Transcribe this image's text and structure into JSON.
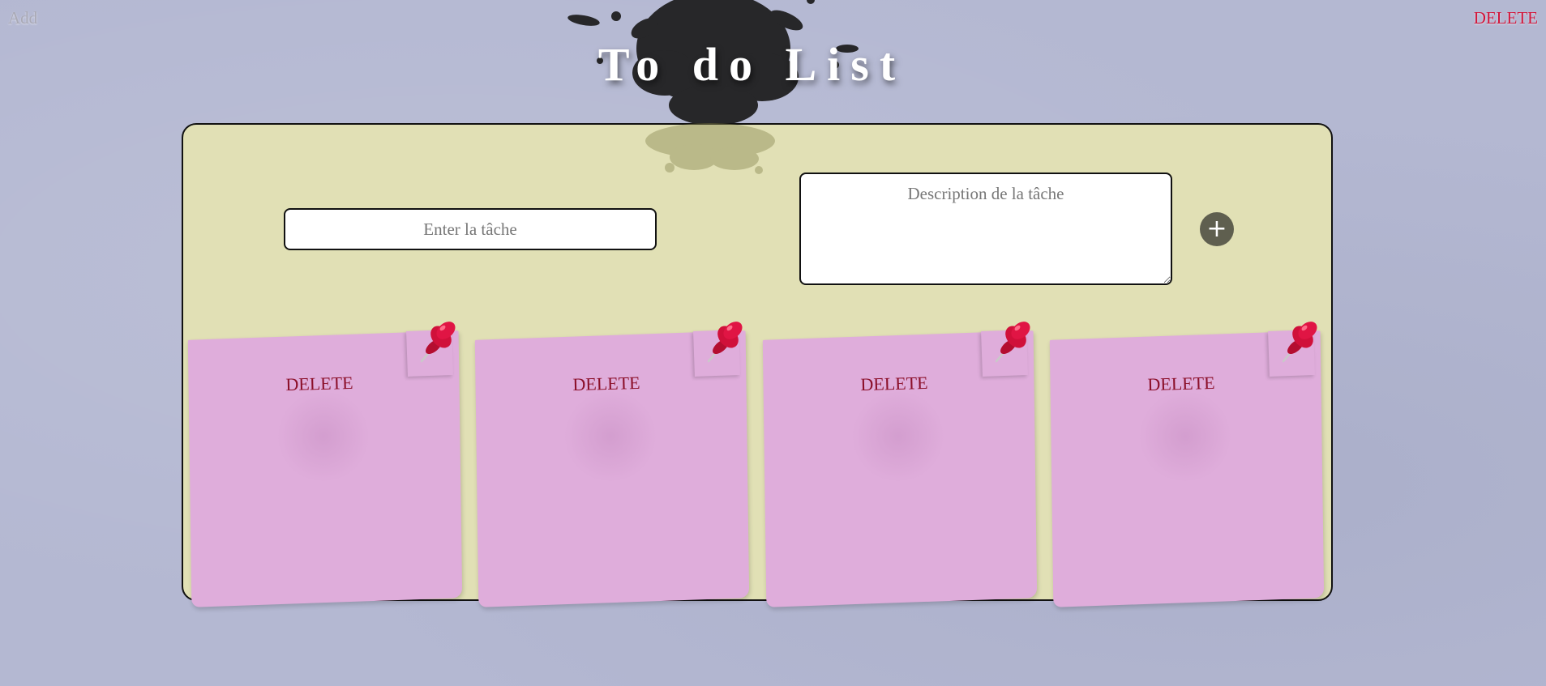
{
  "header": {
    "add_label": "Add",
    "delete_label": "DELETE",
    "title": "To do List"
  },
  "form": {
    "task_placeholder": "Enter la tâche",
    "description_placeholder": "Description de la tâche",
    "add_button_label": "+"
  },
  "notes": [
    {
      "delete_label": "DELETE",
      "icon": "pushpin-icon"
    },
    {
      "delete_label": "DELETE",
      "icon": "pushpin-icon"
    },
    {
      "delete_label": "DELETE",
      "icon": "pushpin-icon"
    },
    {
      "delete_label": "DELETE",
      "icon": "pushpin-icon"
    }
  ],
  "colors": {
    "background": "#b4b8d2",
    "board": "#e1e0b5",
    "note": "#dfaddb",
    "note_text": "#8b0f29",
    "delete_link": "#d3153a",
    "add_button": "#5f5f4f",
    "pin": "#d0103a"
  }
}
